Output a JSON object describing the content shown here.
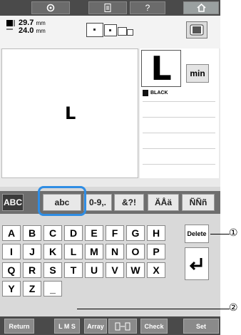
{
  "top_bar": {
    "icons": [
      "gear-icon",
      "document-icon",
      "help-icon",
      "home-icon"
    ],
    "help_label": "?"
  },
  "info": {
    "width_value": "29.7",
    "width_unit": "mm",
    "height_value": "24.0",
    "height_unit": "mm"
  },
  "preview": {
    "glyph": "L"
  },
  "selected_char": {
    "glyph": "L"
  },
  "min_button": "min",
  "thread_color": "BLACK",
  "categories": [
    {
      "label": "ABC",
      "active": true
    },
    {
      "label": "abc",
      "active": false
    },
    {
      "label": "0-9,.",
      "active": false
    },
    {
      "label": "&?!",
      "active": false
    },
    {
      "label": "ÄÅä",
      "active": false
    },
    {
      "label": "ÑÑñ",
      "active": false
    }
  ],
  "keys": {
    "row1": [
      "A",
      "B",
      "C",
      "D",
      "E",
      "F",
      "G",
      "H"
    ],
    "row2": [
      "I",
      "J",
      "K",
      "L",
      "M",
      "N",
      "O",
      "P"
    ],
    "row3": [
      "Q",
      "R",
      "S",
      "T",
      "U",
      "V",
      "W",
      "X"
    ],
    "row4": [
      "Y",
      "Z",
      "_"
    ]
  },
  "delete_label": "Delete",
  "bottom": {
    "return": "Return",
    "lms": "L M S",
    "array": "Array",
    "check": "Check",
    "set": "Set"
  },
  "callouts": [
    "①",
    "②"
  ]
}
